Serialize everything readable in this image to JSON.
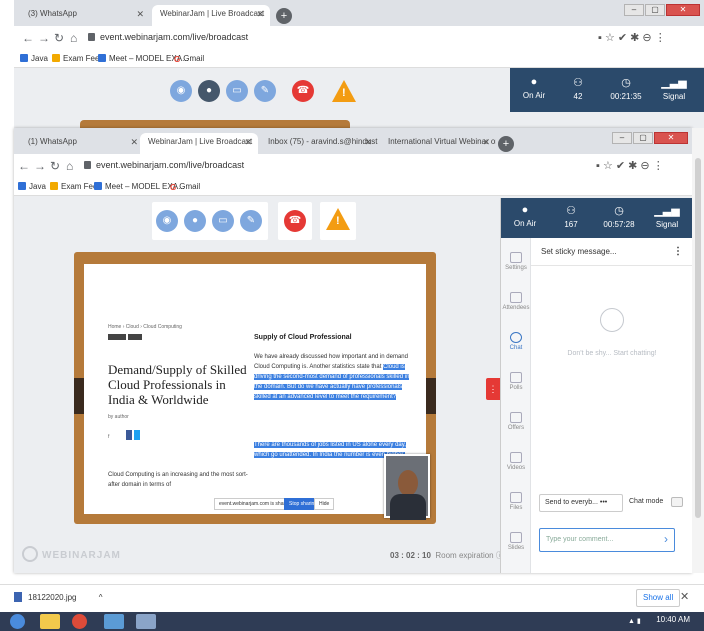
{
  "bg_window": {
    "tabs": [
      {
        "label": "(3) WhatsApp",
        "active": false
      },
      {
        "label": "WebinarJam | Live Broadcast",
        "active": true
      }
    ],
    "url": "event.webinarjam.com/live/broadcast",
    "bookmarks": [
      "Java",
      "Exam Fee",
      "Meet – MODEL EXA...",
      "Gmail"
    ],
    "stats": [
      {
        "icon": "mic-icon",
        "label": "On Air",
        "value": ""
      },
      {
        "icon": "attendees-icon",
        "label": "Attendees",
        "value": "42"
      },
      {
        "icon": "clock-icon",
        "label": "Time",
        "value": "00:21:35"
      },
      {
        "icon": "signal-icon",
        "label": "Signal",
        "value": "Signal"
      }
    ]
  },
  "fg_window": {
    "tabs": [
      {
        "label": "(1) WhatsApp"
      },
      {
        "label": "WebinarJam | Live Broadcast"
      },
      {
        "label": "Inbox (75) - aravind.s@hindusth..."
      },
      {
        "label": "International Virtual Webinar on..."
      }
    ],
    "url": "event.webinarjam.com/live/broadcast",
    "bookmarks": [
      "Java",
      "Exam Fee",
      "Meet – MODEL EXA...",
      "Gmail"
    ],
    "stats": {
      "on_air": "On Air",
      "attendees": "167",
      "time": "00:57:28",
      "signal": "Signal"
    }
  },
  "slide": {
    "title": "Demand/Supply of Skilled Cloud Professionals in India & Worldwide",
    "section_heading": "Supply of Cloud Professional",
    "para1_plain": "We have already discussed how important and in demand Cloud Computing is. Another statistics state that",
    "para1_hl": "Cloud is driving the second-most demand of professionals skilled in the domain. But do we have actually have professionals skilled at an advanced level to meet the requirement?",
    "para2_hl": "There are thousands of jobs listed in US alone every day, which go unattended. In India the number is even higher.",
    "footer_text": "Cloud Computing is an increasing and the most sort-after domain in terms of",
    "btn_share": "Stop sharing",
    "btn_hide": "Hide",
    "share_note": "event.webinarjam.com is sharing your screen."
  },
  "stage": {
    "brand": "WEBINARJAM",
    "timer_value": "03 : 02 : 10",
    "timer_label": "Room expiration"
  },
  "panel": {
    "sticky_placeholder": "Set sticky message...",
    "nav": [
      "Settings",
      "Attendees",
      "Chat",
      "Polls",
      "Offers",
      "Videos",
      "Files",
      "Slides"
    ],
    "empty_msg": "Don't be shy... Start chatting!",
    "send_to": "Send to everyb...",
    "chat_mode": "Chat mode",
    "comment_placeholder": "Type your comment..."
  },
  "downloads": {
    "file": "18122020.jpg",
    "show_all": "Show all"
  },
  "taskbar": {
    "time": "10:40 AM"
  }
}
